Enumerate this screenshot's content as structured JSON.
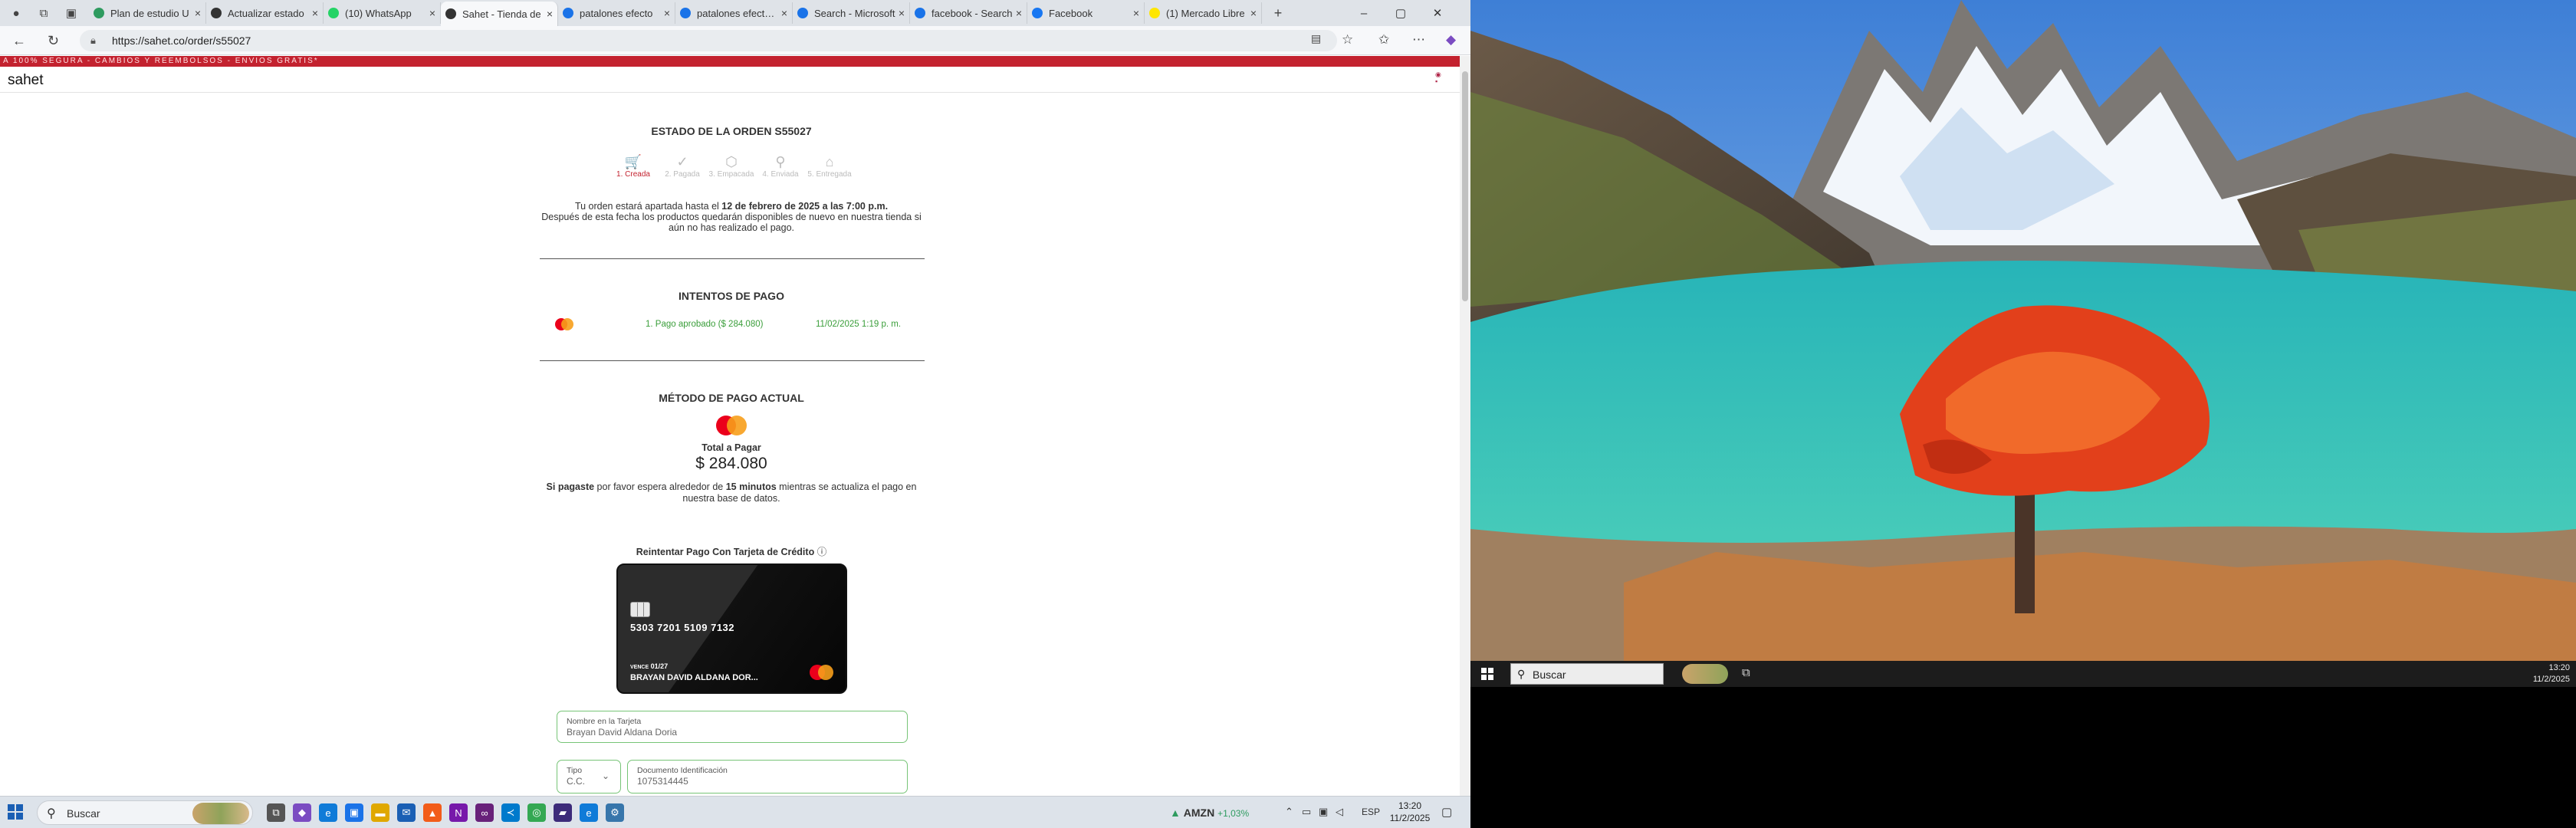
{
  "browser": {
    "tabs": [
      {
        "label": "Plan de estudio U",
        "color": "#2e9b5f",
        "active": false
      },
      {
        "label": "Actualizar estado",
        "color": "#333333",
        "active": false
      },
      {
        "label": "(10) WhatsApp",
        "color": "#25d366",
        "active": false
      },
      {
        "label": "Sahet - Tienda de",
        "color": "#333333",
        "active": true
      },
      {
        "label": "patalones efecto",
        "color": "#1a73e8",
        "active": false
      },
      {
        "label": "patalones efecto p",
        "color": "#1a73e8",
        "active": false
      },
      {
        "label": "Search - Microsoft",
        "color": "#1a73e8",
        "active": false
      },
      {
        "label": "facebook - Search",
        "color": "#1a73e8",
        "active": false
      },
      {
        "label": "Facebook",
        "color": "#1877f2",
        "active": false
      },
      {
        "label": "(1) Mercado Libre",
        "color": "#ffe600",
        "active": false
      }
    ],
    "new_tab": "+",
    "url": "https://sahet.co/order/s55027"
  },
  "site": {
    "promo": "A 100% SEGURA  -  CAMBIOS Y REEMBOLSOS  -  ENVIOS GRATIS*",
    "logo": "sahet"
  },
  "order": {
    "title": "ESTADO DE LA ORDEN S55027",
    "steps": [
      {
        "label": "1. Creada",
        "icon": "cart-icon",
        "glyph": "🛒",
        "active": true
      },
      {
        "label": "2. Pagada",
        "icon": "check-circle-icon",
        "glyph": "✓",
        "active": false
      },
      {
        "label": "3. Empacada",
        "icon": "box-icon",
        "glyph": "⬡",
        "active": false
      },
      {
        "label": "4. Enviada",
        "icon": "location-pin-icon",
        "glyph": "⚲",
        "active": false
      },
      {
        "label": "5. Entregada",
        "icon": "home-icon",
        "glyph": "⌂",
        "active": false
      }
    ],
    "note_prefix": "Tu orden estará apartada hasta el ",
    "note_date": "12 de febrero de 2025 a las 7:00 p.m.",
    "note_rest": "Después de esta fecha los productos quedarán disponibles de nuevo en nuestra tienda si aún no has realizado el pago."
  },
  "attempts": {
    "title": "INTENTOS DE PAGO",
    "items": [
      {
        "status": "1. Pago aprobado ($ 284.080)",
        "date": "11/02/2025 1:19 p. m."
      }
    ]
  },
  "payment": {
    "title": "MÉTODO DE PAGO ACTUAL",
    "total_label": "Total a Pagar",
    "total_amount": "$ 284.080",
    "paid_bold": "Si pagaste",
    "paid_mid": " por favor espera alrededor de ",
    "paid_minutes": "15 minutos",
    "paid_rest": " mientras se actualiza el pago en nuestra base de datos.",
    "retry_title": "Reintentar Pago Con Tarjeta de Crédito",
    "info_glyph": "ⓘ"
  },
  "card": {
    "number": "5303 7201 5109 7132",
    "vence_label": "VENCE",
    "expiry": "01/27",
    "holder": "BRAYAN DAVID ALDANA DOR..."
  },
  "form": {
    "name_label": "Nombre en la Tarjeta",
    "name_value": "Brayan David Aldana Doria",
    "type_label": "Tipo",
    "type_value": "C.C.",
    "doc_label": "Documento Identificación",
    "doc_value": "1075314445"
  },
  "taskbar": {
    "search": "Buscar",
    "stock_symbol": "AMZN",
    "stock_change": "+1,03%",
    "lang": "ESP",
    "time": "13:20",
    "date": "11/2/2025"
  },
  "desktop": {
    "search": "Buscar",
    "time": "13:20",
    "date": "11/2/2025"
  },
  "colors": {
    "accent_red": "#c3222f",
    "success_green": "#3a9e3a",
    "field_border": "#77c477"
  }
}
